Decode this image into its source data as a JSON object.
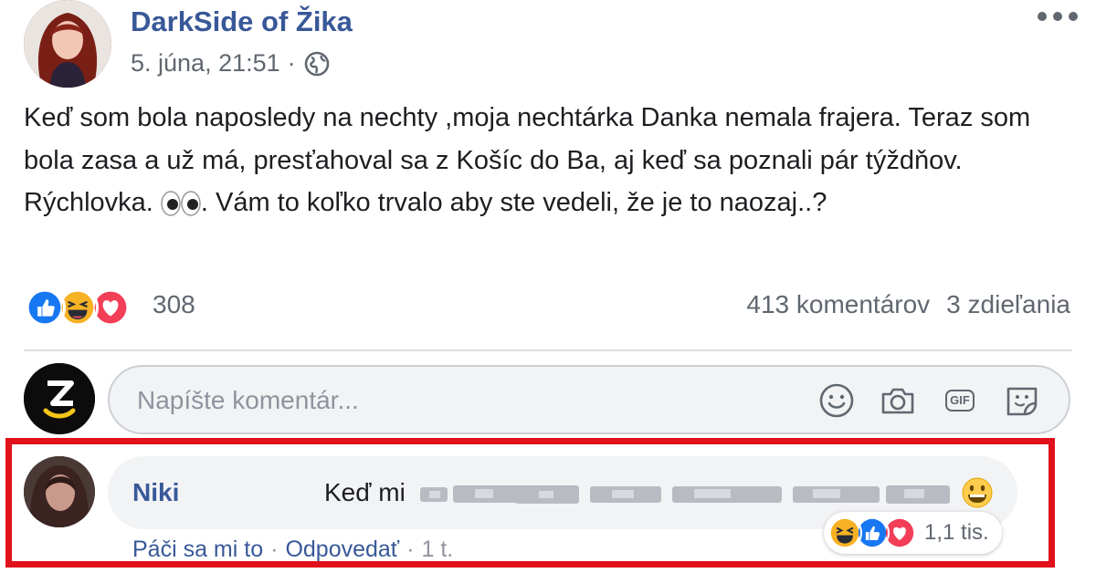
{
  "post": {
    "page_name": "DarkSide of Žika",
    "date": "5. júna, 21:51",
    "meta_separator": "·",
    "text_parts": [
      "Keď som bola naposledy na nechty ,moja nechtárka Danka nemala frajera. Teraz som bola zasa a už má, presťahoval sa z Košíc do Ba, aj keď sa poznali pár týždňov. Rýchlovka. ",
      ". Vám to koľko trvalo aby ste vedeli, že je to naozaj..?"
    ],
    "reactions": [
      "like",
      "haha",
      "love"
    ],
    "reaction_count": "308",
    "comments_count": "413 komentárov",
    "shares_count": "3 zdieľania"
  },
  "composer": {
    "placeholder": "Napíšte komentár...",
    "icons": [
      "smiley-icon",
      "camera-icon",
      "gif-icon",
      "sticker-icon"
    ],
    "gif_label": "GIF"
  },
  "comment": {
    "author": "Niki",
    "text_visible": "Keď mi",
    "actions": {
      "like": "Páči sa mi to",
      "reply": "Odpovedať",
      "time": "1 t."
    },
    "separator": "·",
    "reactions": [
      "haha",
      "like",
      "love"
    ],
    "reaction_count": "1,1 tis."
  },
  "colors": {
    "link": "#385898",
    "highlight": "#e0111b",
    "like_blue": "#1877f2",
    "love_red": "#f33e58",
    "haha_yellow": "#f7b125"
  }
}
